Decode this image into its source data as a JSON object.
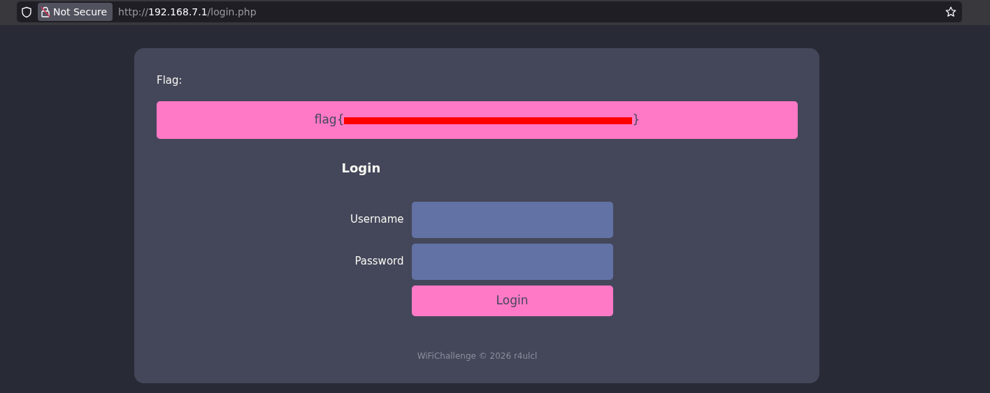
{
  "browser": {
    "security_label": "Not Secure",
    "url": {
      "scheme": "http://",
      "host": "192.168.7.1",
      "path": "/login.php"
    }
  },
  "flag": {
    "label": "Flag:",
    "prefix": "flag{",
    "suffix": "}",
    "redacted": true
  },
  "login": {
    "heading": "Login",
    "fields": [
      {
        "label": "Username"
      },
      {
        "label": "Password"
      }
    ],
    "button": "Login"
  },
  "footer": "WiFiChallenge © 2026 r4ulcl"
}
